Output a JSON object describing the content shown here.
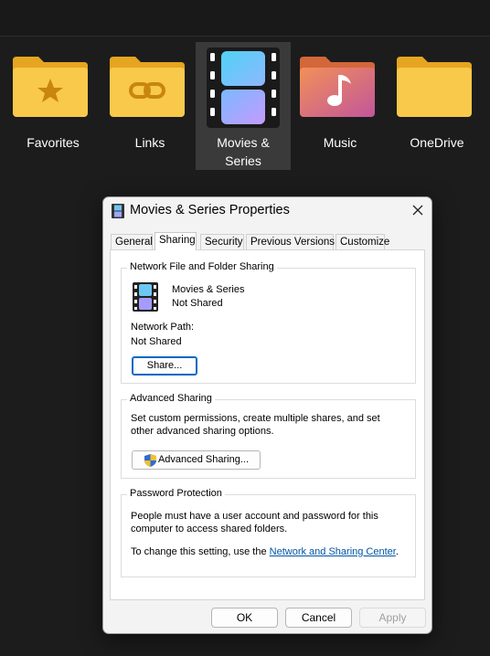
{
  "folders": [
    {
      "label": "Favorites",
      "icon": "star-folder-icon"
    },
    {
      "label": "Links",
      "icon": "link-folder-icon"
    },
    {
      "label": "Movies &\nSeries",
      "label_line1": "Movies &",
      "label_line2": "Series",
      "icon": "film-icon",
      "selected": true
    },
    {
      "label": "Music",
      "icon": "music-folder-icon"
    },
    {
      "label": "OneDrive",
      "icon": "folder-icon"
    }
  ],
  "dialog": {
    "title": "Movies & Series Properties",
    "tabs": [
      "General",
      "Sharing",
      "Security",
      "Previous Versions",
      "Customize"
    ],
    "active_tab": "Sharing",
    "network_sharing": {
      "title": "Network File and Folder Sharing",
      "item_name": "Movies & Series",
      "item_status": "Not Shared",
      "path_label": "Network Path:",
      "path_value": "Not Shared",
      "share_button": "Share..."
    },
    "advanced_sharing": {
      "title": "Advanced Sharing",
      "description": "Set custom permissions, create multiple shares, and set other advanced sharing options.",
      "button": "Advanced Sharing..."
    },
    "password_protection": {
      "title": "Password Protection",
      "description": "People must have a user account and password for this computer to access shared folders.",
      "change_prefix": "To change this setting, use the ",
      "link_text": "Network and Sharing Center",
      "change_suffix": "."
    },
    "buttons": {
      "ok": "OK",
      "cancel": "Cancel",
      "apply": "Apply"
    }
  },
  "colors": {
    "accent": "#0067c0",
    "background": "#1c1c1c",
    "folder_yellow": "#f5c242",
    "link": "#0054a6"
  }
}
